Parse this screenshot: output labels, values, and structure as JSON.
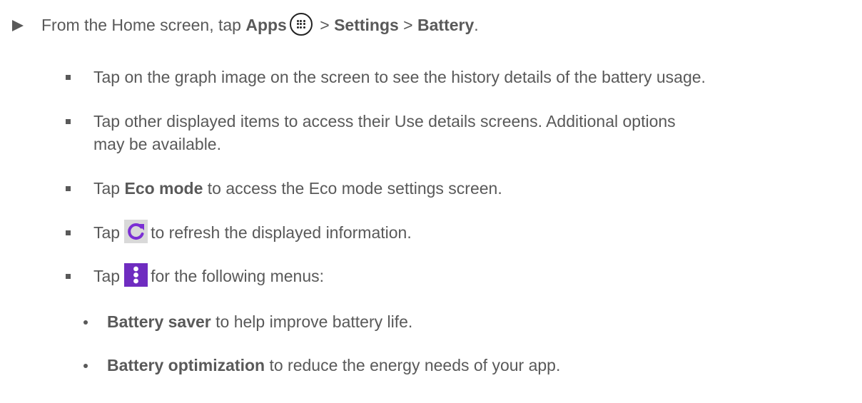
{
  "step": {
    "prefix": "From the Home screen, tap ",
    "apps": "Apps",
    "sep1": " > ",
    "settings": "Settings",
    "sep2": " > ",
    "battery": "Battery",
    "end": "."
  },
  "bullets": {
    "graph": "Tap on the graph image on the screen to see the history details of the battery usage.",
    "other_line1": "Tap other displayed items to access their Use details screens. Additional options",
    "other_line2": "may be available.",
    "eco_pre": "Tap ",
    "eco_bold": "Eco mode",
    "eco_post": " to access the Eco mode settings screen.",
    "refresh_pre": "Tap",
    "refresh_post": "to refresh the displayed information.",
    "menu_pre": "Tap",
    "menu_post": "for the following menus:"
  },
  "sub_items": {
    "saver_bold": "Battery saver",
    "saver_post": " to help improve battery life.",
    "opt_bold": "Battery optimization",
    "opt_post": " to reduce the energy needs of your app."
  },
  "icons": {
    "apps": "apps-grid-icon",
    "refresh": "refresh-icon",
    "menu": "more-vert-icon",
    "refresh_color": "#7b2fd4",
    "menu_color": "#6f2cc0"
  }
}
